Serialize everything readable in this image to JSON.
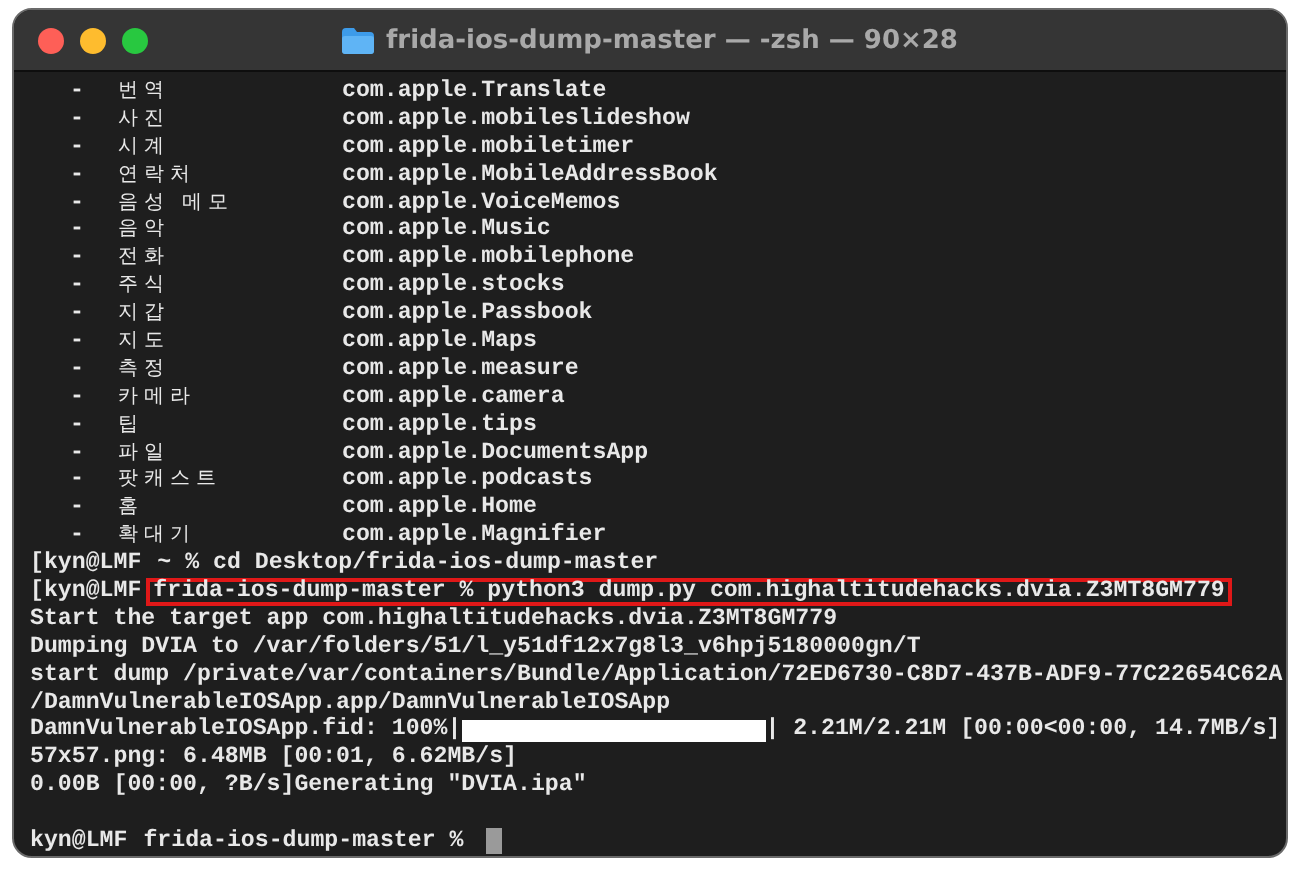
{
  "window": {
    "title": "frida-ios-dump-master — -zsh — 90×28"
  },
  "lines": [
    {
      "kind": "app",
      "bullet": "-",
      "name": "번역",
      "bundle_id": "com.apple.Translate"
    },
    {
      "kind": "app",
      "bullet": "-",
      "name": "사진",
      "bundle_id": "com.apple.mobileslideshow"
    },
    {
      "kind": "app",
      "bullet": "-",
      "name": "시계",
      "bundle_id": "com.apple.mobiletimer"
    },
    {
      "kind": "app",
      "bullet": "-",
      "name": "연락처",
      "bundle_id": "com.apple.MobileAddressBook"
    },
    {
      "kind": "app",
      "bullet": "-",
      "name": "음성 메모",
      "bundle_id": "com.apple.VoiceMemos"
    },
    {
      "kind": "app",
      "bullet": "-",
      "name": "음악",
      "bundle_id": "com.apple.Music"
    },
    {
      "kind": "app",
      "bullet": "-",
      "name": "전화",
      "bundle_id": "com.apple.mobilephone"
    },
    {
      "kind": "app",
      "bullet": "-",
      "name": "주식",
      "bundle_id": "com.apple.stocks"
    },
    {
      "kind": "app",
      "bullet": "-",
      "name": "지갑",
      "bundle_id": "com.apple.Passbook"
    },
    {
      "kind": "app",
      "bullet": "-",
      "name": "지도",
      "bundle_id": "com.apple.Maps"
    },
    {
      "kind": "app",
      "bullet": "-",
      "name": "측정",
      "bundle_id": "com.apple.measure"
    },
    {
      "kind": "app",
      "bullet": "-",
      "name": "카메라",
      "bundle_id": "com.apple.camera"
    },
    {
      "kind": "app",
      "bullet": "-",
      "name": "팁",
      "bundle_id": "com.apple.tips"
    },
    {
      "kind": "app",
      "bullet": "-",
      "name": "파일",
      "bundle_id": "com.apple.DocumentsApp"
    },
    {
      "kind": "app",
      "bullet": "-",
      "name": "팟캐스트",
      "bundle_id": "com.apple.podcasts"
    },
    {
      "kind": "app",
      "bullet": "-",
      "name": "홈",
      "bundle_id": "com.apple.Home"
    },
    {
      "kind": "app",
      "bullet": "-",
      "name": "확대기",
      "bundle_id": "com.apple.Magnifier"
    },
    {
      "kind": "prompt",
      "prompt": "[kyn@LMF",
      "command": "~ % cd Desktop/frida-ios-dump-master",
      "highlighted": false,
      "cursor": false
    },
    {
      "kind": "prompt",
      "prompt": "[kyn@LMF",
      "command": "frida-ios-dump-master % python3 dump.py com.highaltitudehacks.dvia.Z3MT8GM779",
      "highlighted": true,
      "cursor": false
    },
    {
      "kind": "output",
      "text": "Start the target app com.highaltitudehacks.dvia.Z3MT8GM779"
    },
    {
      "kind": "output",
      "text": "Dumping DVIA to /var/folders/51/l_y51df12x7g8l3_v6hpj5180000gn/T"
    },
    {
      "kind": "output",
      "text": "start dump /private/var/containers/Bundle/Application/72ED6730-C8D7-437B-ADF9-77C22654C62A"
    },
    {
      "kind": "output",
      "text": "/DamnVulnerableIOSApp.app/DamnVulnerableIOSApp"
    },
    {
      "kind": "progress",
      "label": "DamnVulnerableIOSApp.fid: 100%|",
      "level": 1,
      "stats": "| 2.21M/2.21M [00:00<00:00, 14.7MB/s]"
    },
    {
      "kind": "output",
      "text": "57x57.png: 6.48MB [00:01, 6.62MB/s]"
    },
    {
      "kind": "output",
      "text": "0.00B [00:00, ?B/s]Generating \"DVIA.ipa\""
    },
    {
      "kind": "blank"
    },
    {
      "kind": "prompt",
      "prompt": "kyn@LMF",
      "command": "frida-ios-dump-master %",
      "highlighted": false,
      "cursor": true
    }
  ]
}
